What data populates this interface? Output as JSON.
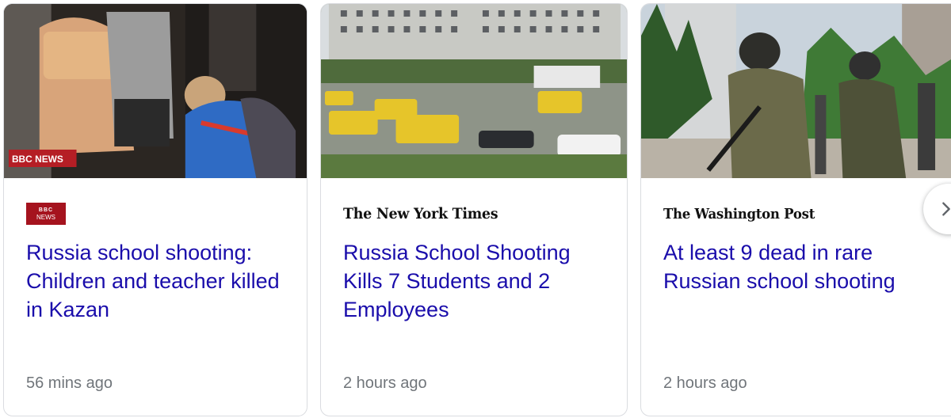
{
  "cards": [
    {
      "source": {
        "logo_top": "BBC",
        "logo_bottom": "NEWS"
      },
      "image_alt": "Rescuer kneeling by people outside school",
      "image_watermark": "BBC NEWS",
      "headline": "Russia school shooting: Children and teacher killed in Kazan",
      "time": "56 mins ago"
    },
    {
      "source": {
        "name": "The New York Times"
      },
      "image_alt": "Ambulances in front of school building",
      "headline": "Russia School Shooting Kills 7 Students and 2 Employees",
      "time": "2 hours ago"
    },
    {
      "source": {
        "name": "The Washington Post"
      },
      "image_alt": "Armed security forces near school",
      "headline": "At least 9 dead in rare Russian school shooting",
      "time": "2 hours ago"
    }
  ],
  "next_button_icon": "chevron-right-icon",
  "colors": {
    "headline": "#1a0dab",
    "time": "#70757a",
    "bbc_red": "#a5131e",
    "border": "#dadce0"
  }
}
